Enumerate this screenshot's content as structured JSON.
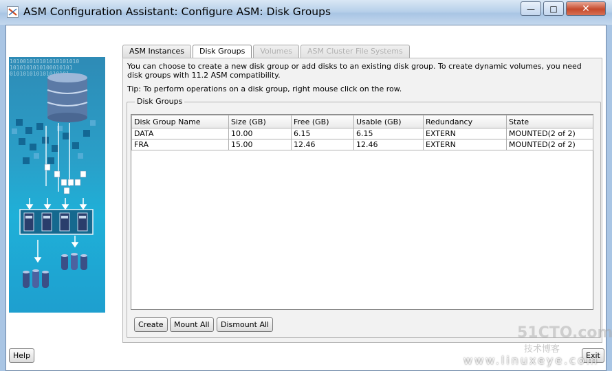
{
  "window": {
    "title": "ASM Configuration Assistant: Configure ASM: Disk Groups",
    "min_glyph": "—",
    "max_glyph": "□",
    "close_glyph": "✕"
  },
  "graphic": {
    "bits_lines": [
      "101001010101010101010",
      "1010101010100010101",
      "010101010101010101"
    ]
  },
  "tabs": [
    {
      "label": "ASM Instances",
      "state": "normal"
    },
    {
      "label": "Disk Groups",
      "state": "active"
    },
    {
      "label": "Volumes",
      "state": "disabled"
    },
    {
      "label": "ASM Cluster File Systems",
      "state": "disabled"
    }
  ],
  "description": "You can choose to create a new disk group or add disks to an existing disk group. To create dynamic volumes, you need disk groups with 11.2 ASM compatibility.",
  "tip": "Tip: To perform operations on a disk group, right mouse click on the row.",
  "disk_groups": {
    "legend": "Disk Groups",
    "columns": [
      "Disk Group Name",
      "Size (GB)",
      "Free (GB)",
      "Usable (GB)",
      "Redundancy",
      "State"
    ],
    "rows": [
      [
        "DATA",
        "10.00",
        "6.15",
        "6.15",
        "EXTERN",
        "MOUNTED(2 of 2)"
      ],
      [
        "FRA",
        "15.00",
        "12.46",
        "12.46",
        "EXTERN",
        "MOUNTED(2 of 2)"
      ]
    ]
  },
  "buttons": {
    "create": "Create",
    "mount_all": "Mount All",
    "dismount_all": "Dismount All",
    "help": "Help",
    "exit": "Exit"
  },
  "watermarks": {
    "site_a": "51CTO.com",
    "site_a_sub": "技术博客",
    "site_b": "www.linuxeye.com"
  }
}
